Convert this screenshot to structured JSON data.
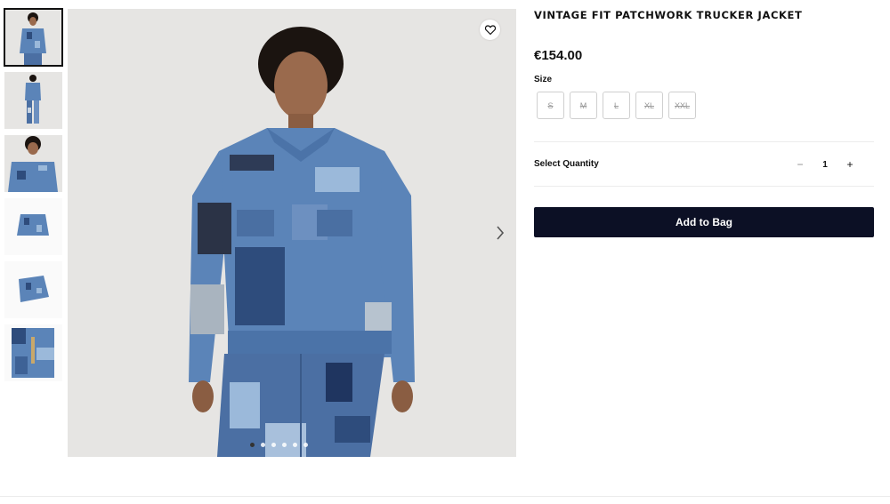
{
  "product": {
    "title": "VINTAGE FIT PATCHWORK TRUCKER JACKET",
    "price": "€154.00"
  },
  "gallery": {
    "thumbnails": [
      {
        "name": "front-portrait",
        "active": true
      },
      {
        "name": "full-length"
      },
      {
        "name": "close-up"
      },
      {
        "name": "flat-front"
      },
      {
        "name": "flat-angle"
      },
      {
        "name": "detail"
      }
    ],
    "slide_count": 6,
    "active_slide": 1
  },
  "size": {
    "label": "Size",
    "options": [
      "S",
      "M",
      "L",
      "XL",
      "XXL"
    ]
  },
  "quantity": {
    "label": "Select Quantity",
    "minus": "−",
    "value": "1",
    "plus": "+"
  },
  "add_to_bag": {
    "label": "Add to Bag"
  },
  "colors": {
    "button_bg": "#0c1025",
    "denim_mid": "#5b84b8",
    "denim_dark": "#2e4c7c",
    "denim_light": "#9bb9da",
    "backdrop": "#e6e5e3"
  },
  "icons": {
    "wishlist": "heart-icon",
    "next": "chevron-right-icon"
  }
}
